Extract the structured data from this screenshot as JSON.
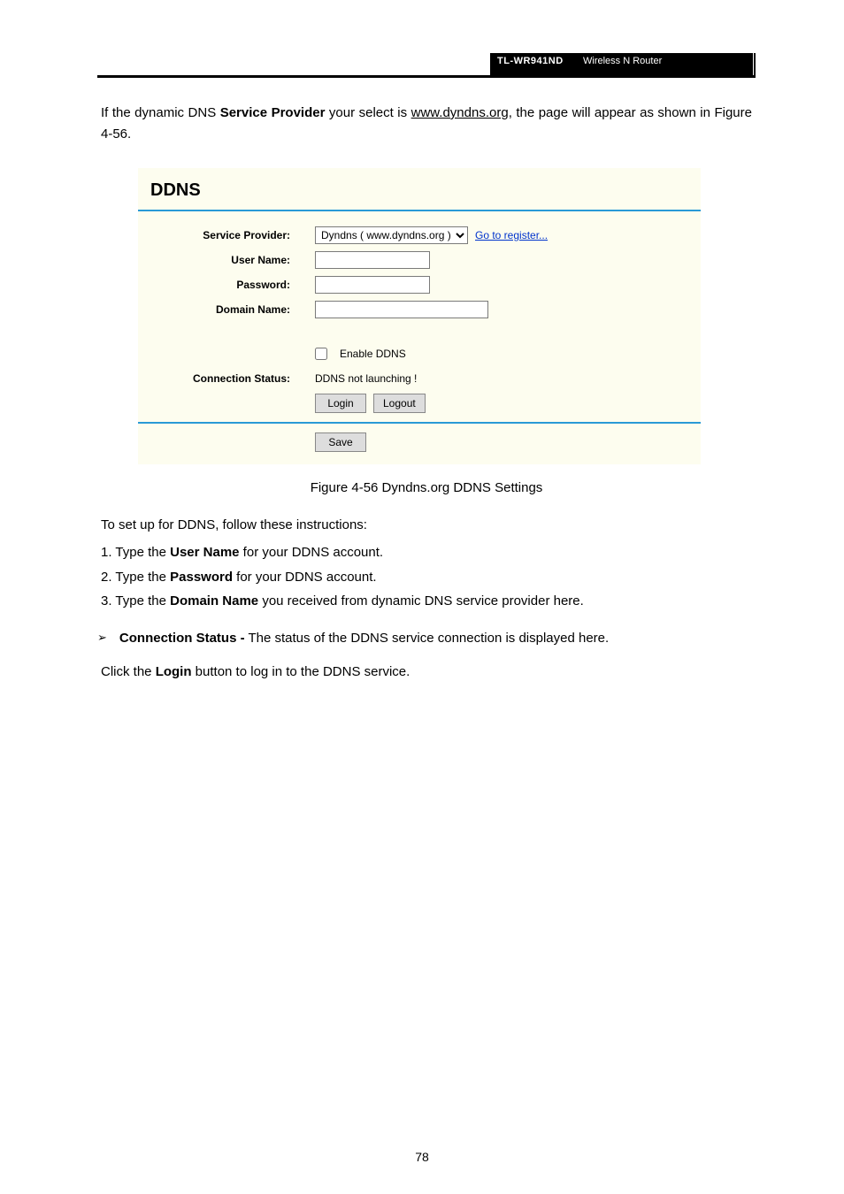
{
  "header": {
    "model": "TL-WR941ND",
    "product": "Wireless N Router"
  },
  "intro_paragraph": "If the dynamic DNS Service Provider your select is www.dyndns.org, the page will appear as shown in Figure 4-56.",
  "figure": {
    "title": "DDNS",
    "labels": {
      "service_provider": "Service Provider:",
      "user_name": "User Name:",
      "password": "Password:",
      "domain_name": "Domain Name:",
      "connection_status": "Connection Status:"
    },
    "service_option": "Dyndns ( www.dyndns.org )",
    "register_link": "Go to register...",
    "enable_label": "Enable DDNS",
    "status_text": "DDNS not launching !",
    "buttons": {
      "login": "Login",
      "logout": "Logout",
      "save": "Save"
    },
    "caption": "Figure 4-56 Dyndns.org DDNS Settings"
  },
  "steps_intro": "To set up for DDNS, follow these instructions:",
  "steps": {
    "s1_a": "1. Type the ",
    "s1_b": "User Name",
    "s1_c": " for your DDNS account.",
    "s2_a": "2. Type the ",
    "s2_b": "Password",
    "s2_c": " for your DDNS account.",
    "s3_a": "3. Type the ",
    "s3_b": "Domain Name",
    "s3_c": " you received from dynamic DNS service provider here."
  },
  "bullet": {
    "label": "Connection Status -",
    "text": "The status of the DDNS service connection is displayed here."
  },
  "login_line_a": "Click the ",
  "login_line_b": "Login",
  "login_line_c": " button to log in to the DDNS service.",
  "page_number": "78"
}
